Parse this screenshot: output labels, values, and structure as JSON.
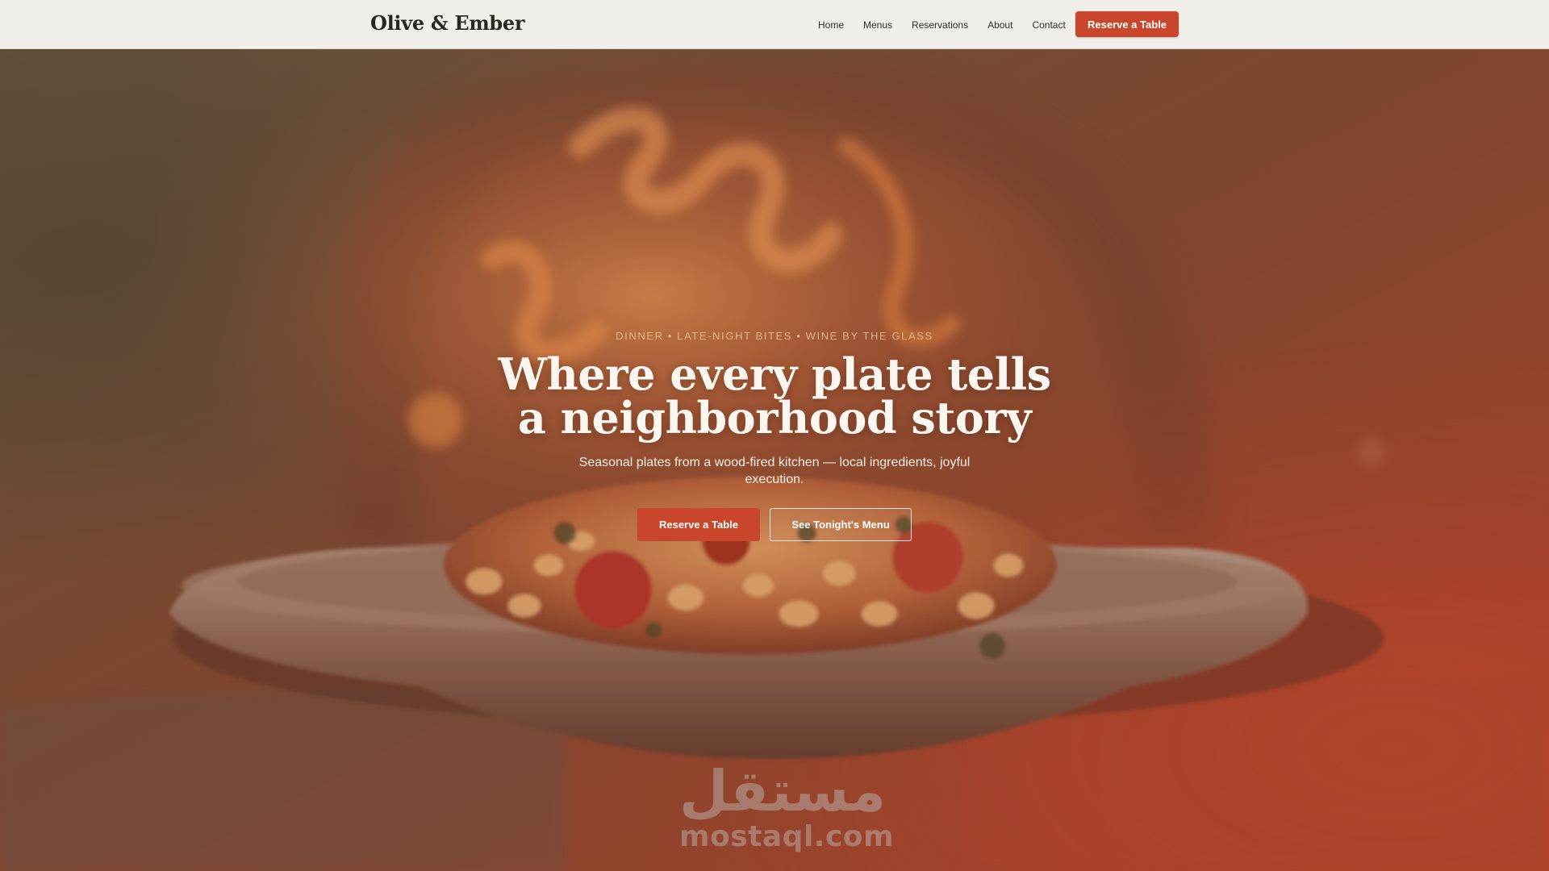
{
  "header": {
    "brand": "Olive & Ember",
    "nav": [
      "Home",
      "Menus",
      "Reservations",
      "About",
      "Contact"
    ],
    "cta_label": "Reserve a Table"
  },
  "hero": {
    "eyebrow": "DINNER • LATE-NIGHT BITES • WINE BY THE GLASS",
    "headline_line1": "Where every plate tells",
    "headline_line2": "a neighborhood story",
    "subhead": "Seasonal plates from a wood-fired kitchen — local ingredients, joyful execution.",
    "primary_button": "Reserve a Table",
    "secondary_button": "See Tonight's Menu"
  },
  "watermark": {
    "arabic": "مستقل",
    "latin": "mostaql.com"
  },
  "colors": {
    "accent": "#c9462c",
    "header_bg": "#f2efeb",
    "eyebrow": "#e9b48a"
  }
}
